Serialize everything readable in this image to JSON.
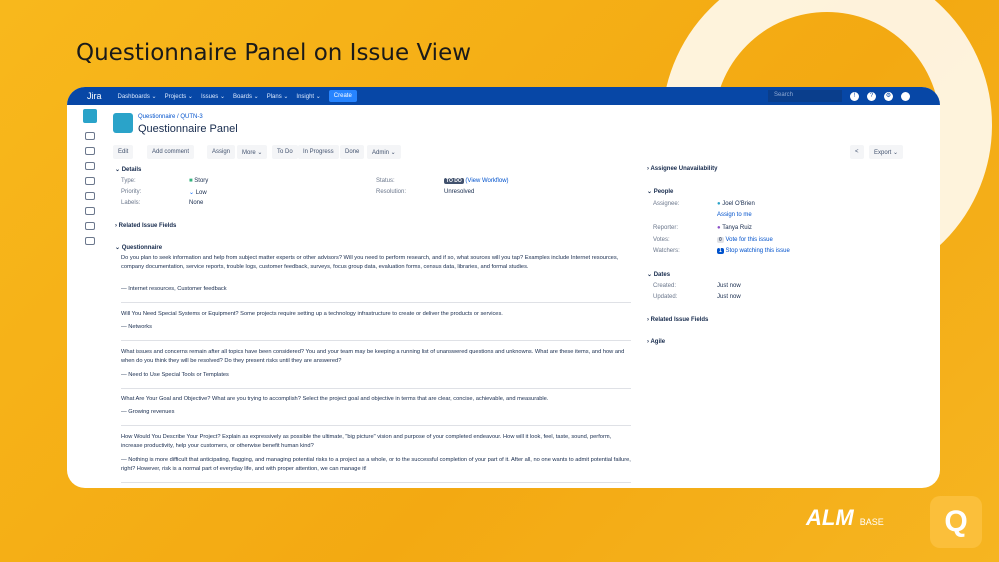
{
  "slide_title": "Questionnaire Panel on Issue View",
  "nav": {
    "logo": "Jira",
    "items": [
      "Dashboards ⌄",
      "Projects ⌄",
      "Issues ⌄",
      "Boards ⌄",
      "Plans ⌄",
      "Insight ⌄"
    ],
    "create": "Create",
    "search_placeholder": "Search"
  },
  "breadcrumb": {
    "project": "Questionnaire",
    "issue_key": "QUTN-3"
  },
  "issue_title": "Questionnaire Panel",
  "toolbar": {
    "edit": "Edit",
    "add_comment": "Add comment",
    "assign": "Assign",
    "more": "More ⌄",
    "todo": "To Do",
    "in_progress": "In Progress",
    "done": "Done",
    "admin": "Admin ⌄",
    "export": "Export ⌄"
  },
  "details": {
    "heading": "Details",
    "type_label": "Type:",
    "type": "Story",
    "priority_label": "Priority:",
    "priority": "Low",
    "labels_label": "Labels:",
    "labels": "None",
    "status_label": "Status:",
    "status": "TO DO",
    "workflow": "(View Workflow)",
    "resolution_label": "Resolution:",
    "resolution": "Unresolved"
  },
  "related_fields": "Related Issue Fields",
  "questionnaire": {
    "heading": "Questionnaire",
    "items": [
      {
        "q": "Do you plan to seek information and help from subject matter experts or other advisors? Will you need to perform research, and if so, what sources will you tap? Examples include Internet resources, company documentation, service reports, trouble logs, customer feedback, surveys, focus group data, evaluation forms, census data, libraries, and formal studies.",
        "a": "— Internet resources, Customer feedback"
      },
      {
        "q": "Will You Need Special Systems or Equipment? Some projects require setting up a technology infrastructure to create or deliver the products or services.",
        "a": "— Networks"
      },
      {
        "q": "What issues and concerns remain after all topics have been considered? You and your team may be keeping a running list of unanswered questions and unknowns. What are these items, and how and when do you think they will be resolved? Do they present risks until they are answered?",
        "a": "— Need to Use Special Tools or Templates"
      },
      {
        "q": "What Are Your Goal and Objective? What are you trying to accomplish? Select the project goal and objective in terms that are clear, concise, achievable, and measurable.",
        "a": "— Growing revenues"
      },
      {
        "q": "How Would You Describe Your Project? Explain as expressively as possible the ultimate, \"big picture\" vision and purpose of your completed endeavour. How will it look, feel, taste, sound, perform, increase productivity, help your customers, or otherwise benefit human kind?",
        "a": "— Nothing is more difficult that anticipating, flagging, and managing potential risks to a project as a whole, or to the successful completion of your part of it. After all, no one wants to admit potential failure, right? However, risk is a normal part of everyday life, and with proper attention, we can manage it!"
      }
    ]
  },
  "right": {
    "unavailability": "Assignee Unavailability",
    "people": "People",
    "assignee_label": "Assignee:",
    "assignee": "Joel O'Brien",
    "assign_to_me": "Assign to me",
    "reporter_label": "Reporter:",
    "reporter": "Tanya Ruiz",
    "votes_label": "Votes:",
    "votes": "0",
    "vote_link": "Vote for this issue",
    "watchers_label": "Watchers:",
    "watchers": "1",
    "watch_link": "Stop watching this issue",
    "dates": "Dates",
    "created_label": "Created:",
    "created": "Just now",
    "updated_label": "Updated:",
    "updated": "Just now",
    "related": "Related Issue Fields",
    "agile": "Agile"
  },
  "brand": {
    "alm": "ALM",
    "base": "BASE",
    "q": "Q"
  }
}
